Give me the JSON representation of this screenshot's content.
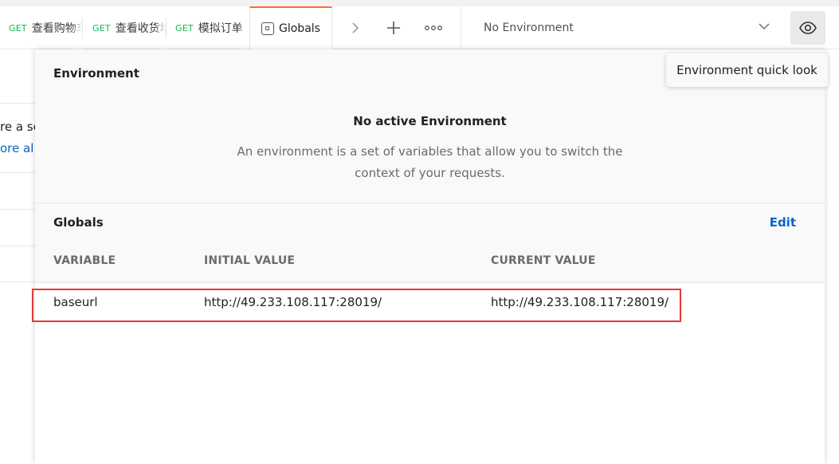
{
  "tabs": [
    {
      "method": "GET",
      "name": "查看购物车"
    },
    {
      "method": "GET",
      "name": "查看收货地址"
    },
    {
      "method": "GET",
      "name": "模拟订单"
    }
  ],
  "active_tab": {
    "name": "Globals"
  },
  "toolbar": {
    "chevron_icon": "chevron-right-icon",
    "plus_icon": "plus-icon",
    "more_icon": "more-horizontal-icon"
  },
  "environment": {
    "selected": "No Environment",
    "eye_icon": "eye-icon"
  },
  "tooltip": "Environment quick look",
  "background": {
    "line1": "re a se",
    "line2": "ore al"
  },
  "quicklook": {
    "header": "Environment",
    "empty_title": "No active Environment",
    "empty_desc_line1": "An environment is a set of variables that allow you to switch the",
    "empty_desc_line2": "context of your requests.",
    "globals_label": "Globals",
    "edit_label": "Edit",
    "columns": [
      "VARIABLE",
      "INITIAL VALUE",
      "CURRENT VALUE"
    ],
    "rows": [
      {
        "variable": "baseurl",
        "initial": "http://49.233.108.117:28019/",
        "current": "http://49.233.108.117:28019/"
      }
    ]
  },
  "colors": {
    "accent": "#ff6c37",
    "link": "#0b63c4",
    "method_get": "#0cbb52",
    "highlight": "#e53935"
  }
}
